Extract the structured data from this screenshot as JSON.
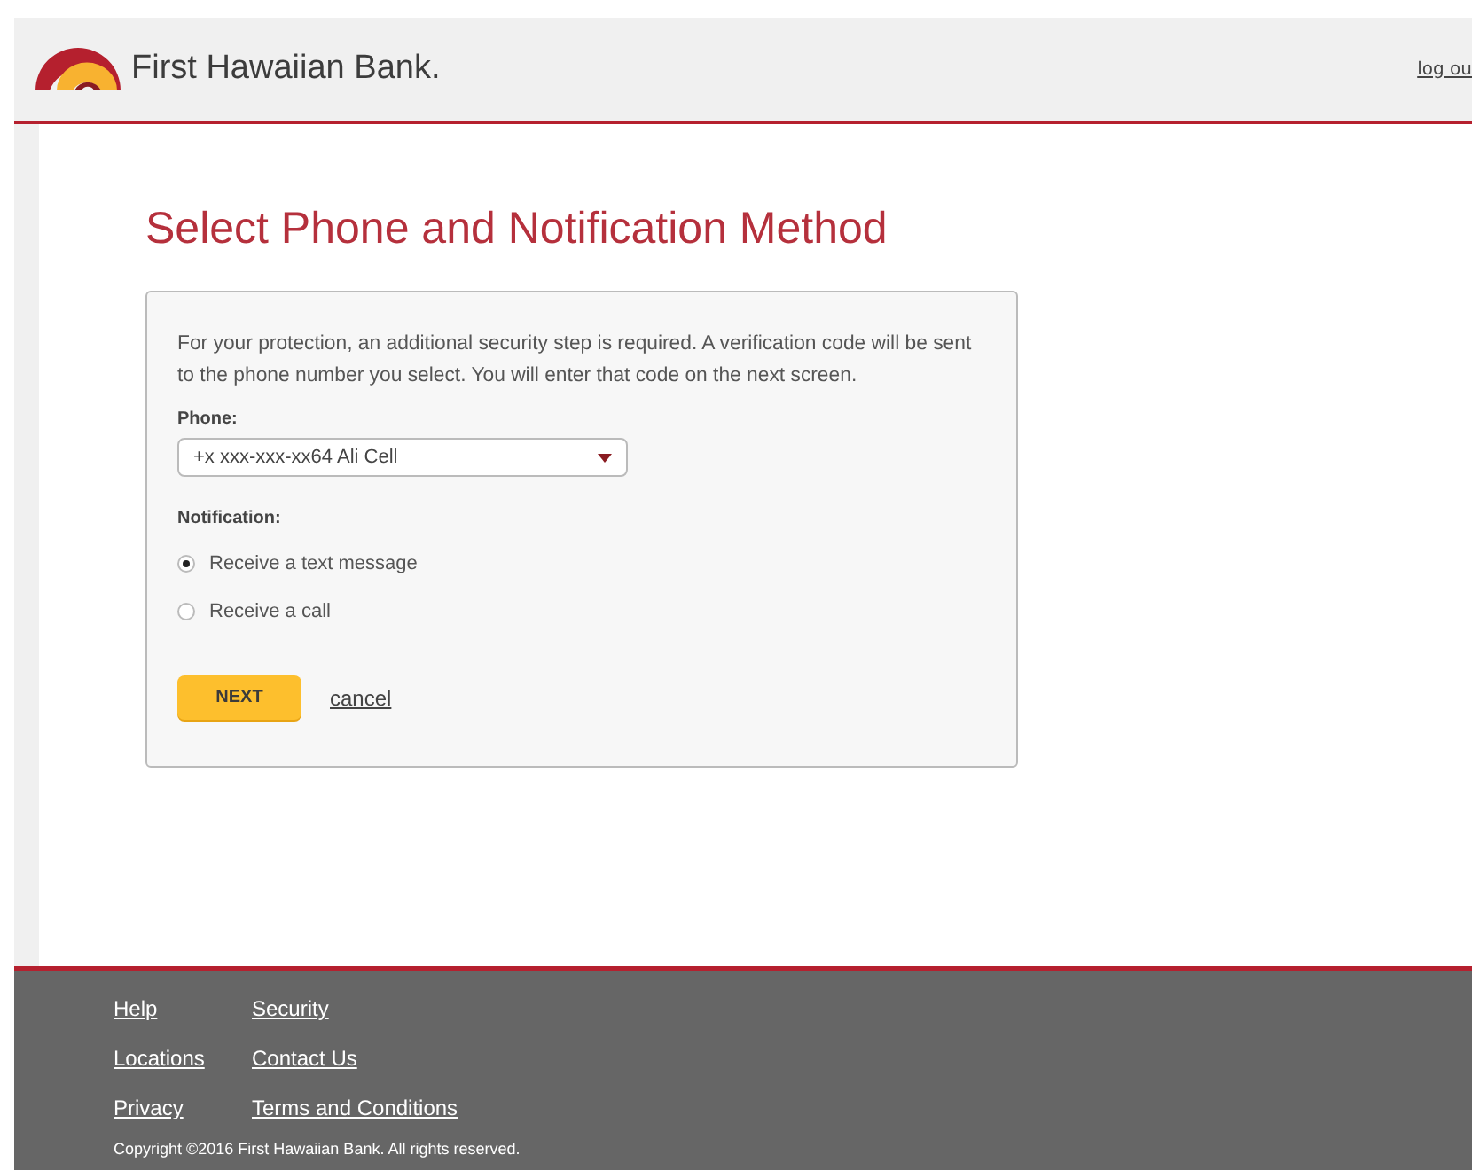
{
  "header": {
    "brand": "First Hawaiian Bank.",
    "logout": "log ou"
  },
  "title": "Select Phone and Notification Method",
  "intro": "For your protection, an additional security step is required. A verification code will be sent to the phone number you select. You will enter that code on the next screen.",
  "phone": {
    "label": "Phone:",
    "value": "+x xxx-xxx-xx64 Ali Cell"
  },
  "notification": {
    "label": "Notification:",
    "options": [
      {
        "label": "Receive a text message",
        "selected": true
      },
      {
        "label": "Receive a call",
        "selected": false
      }
    ]
  },
  "buttons": {
    "next": "NEXT",
    "cancel": "cancel"
  },
  "footer": {
    "links": [
      [
        "Help",
        "Security"
      ],
      [
        "Locations",
        "Contact Us"
      ],
      [
        "Privacy",
        "Terms and Conditions"
      ]
    ],
    "copyright": "Copyright ©2016 First Hawaiian Bank. All rights reserved."
  }
}
